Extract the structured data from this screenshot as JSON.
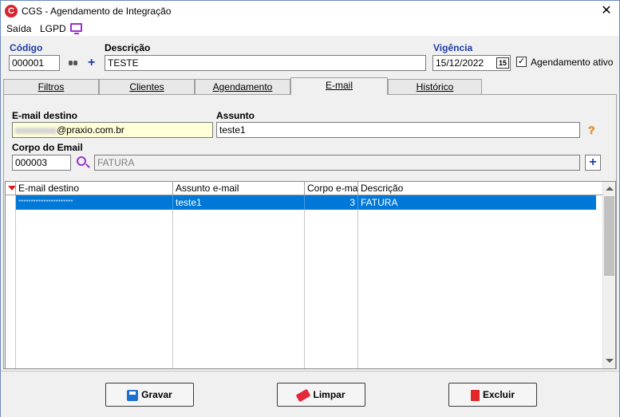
{
  "window": {
    "title": "CGS - Agendamento de Integração",
    "logo_letter": "C"
  },
  "menu": {
    "items": [
      "Saída",
      "LGPD"
    ]
  },
  "header": {
    "codigo_label": "Código",
    "codigo_value": "000001",
    "descricao_label": "Descrição",
    "descricao_value": "TESTE",
    "vigencia_label": "Vigência",
    "vigencia_value": "15/12/2022",
    "calendar_text": "15",
    "agendamento_ativo_label": "Agendamento ativo",
    "agendamento_ativo_checked": true
  },
  "tabs": [
    {
      "label": "Filtros",
      "active": false
    },
    {
      "label": "Clientes",
      "active": false
    },
    {
      "label": "Agendamento",
      "active": false
    },
    {
      "label": "E-mail",
      "active": true
    },
    {
      "label": "Histórico",
      "active": false
    }
  ],
  "email_form": {
    "email_destino_label": "E-mail destino",
    "email_destino_value": "@praxio.com.br",
    "assunto_label": "Assunto",
    "assunto_value": "teste1",
    "corpo_label": "Corpo do Email",
    "corpo_code": "000003",
    "corpo_desc": "FATURA"
  },
  "grid": {
    "columns": [
      "E-mail destino",
      "Assunto e-mail",
      "Corpo e-mail",
      "Descrição"
    ],
    "rows": [
      {
        "email": "**********************",
        "assunto": "teste1",
        "corpo": "3",
        "descricao": "FATURA"
      }
    ]
  },
  "buttons": {
    "gravar": "Gravar",
    "limpar": "Limpar",
    "excluir": "Excluir"
  },
  "colors": {
    "selection": "#0078d7",
    "label_blue": "#1f3ca8",
    "input_highlight": "#ffffd8"
  }
}
